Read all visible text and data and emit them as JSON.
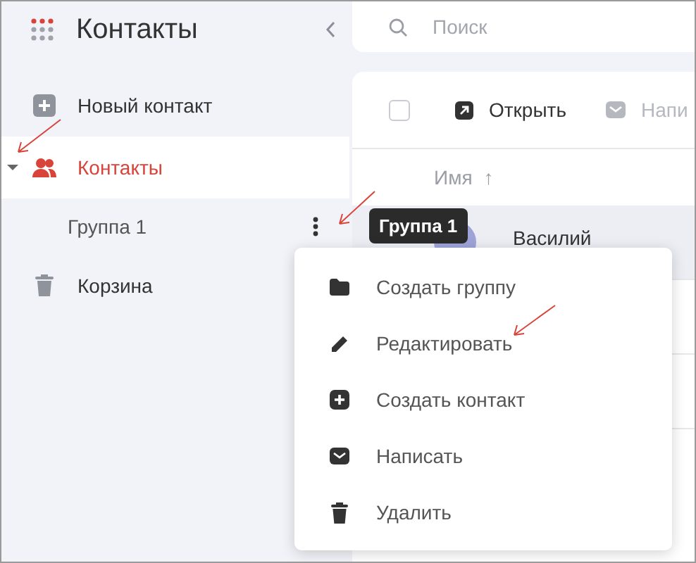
{
  "app": {
    "title": "Контакты"
  },
  "sidebar": {
    "items": [
      {
        "kind": "new",
        "label": "Новый контакт",
        "selected": false
      },
      {
        "kind": "contacts",
        "label": "Контакты",
        "selected": true,
        "expanded": true,
        "children": [
          {
            "label": "Группа 1",
            "selected": false
          }
        ]
      },
      {
        "kind": "trash",
        "label": "Корзина",
        "selected": false
      }
    ]
  },
  "search": {
    "placeholder": "Поиск"
  },
  "toolbar": {
    "select_all": {
      "checked": false
    },
    "buttons": [
      {
        "kind": "open",
        "label": "Открыть",
        "disabled": false
      },
      {
        "kind": "mail",
        "label": "Напи",
        "disabled": true
      }
    ]
  },
  "table": {
    "columns": [
      {
        "label": "Имя",
        "sort_icon": "↑"
      }
    ],
    "rows": [
      {
        "name": "Василий",
        "selected": true
      }
    ]
  },
  "tooltip": {
    "text": "Группа 1"
  },
  "context_menu": {
    "items": [
      {
        "kind": "folder",
        "label": "Создать группу"
      },
      {
        "kind": "edit",
        "label": "Редактировать"
      },
      {
        "kind": "add",
        "label": "Создать контакт"
      },
      {
        "kind": "mail",
        "label": "Написать"
      },
      {
        "kind": "delete",
        "label": "Удалить"
      }
    ]
  }
}
